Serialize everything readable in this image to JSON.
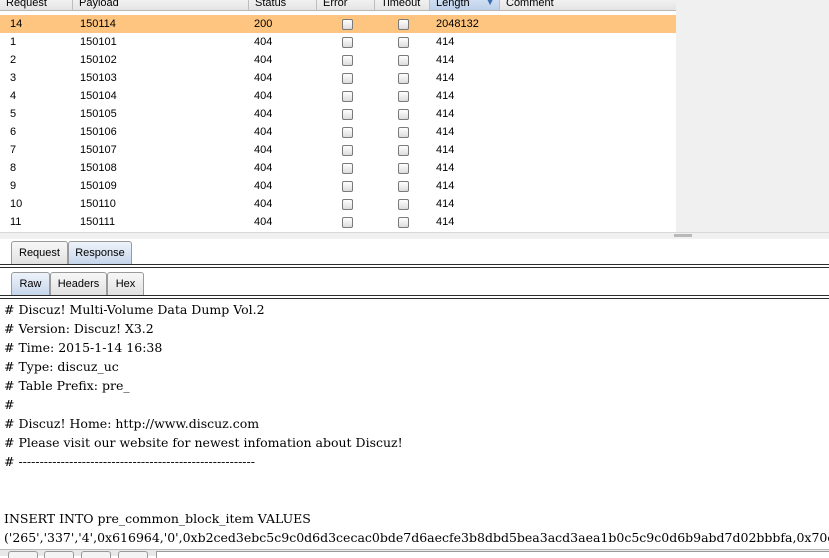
{
  "table": {
    "columns": [
      "Request",
      "Payload",
      "Status",
      "Error",
      "Timeout",
      "Length",
      "Comment"
    ],
    "sorted_column": "Length",
    "rows": [
      {
        "request": "14",
        "payload": "150114",
        "status": "200",
        "length": "2048132"
      },
      {
        "request": "1",
        "payload": "150101",
        "status": "404",
        "length": "414"
      },
      {
        "request": "2",
        "payload": "150102",
        "status": "404",
        "length": "414"
      },
      {
        "request": "3",
        "payload": "150103",
        "status": "404",
        "length": "414"
      },
      {
        "request": "4",
        "payload": "150104",
        "status": "404",
        "length": "414"
      },
      {
        "request": "5",
        "payload": "150105",
        "status": "404",
        "length": "414"
      },
      {
        "request": "6",
        "payload": "150106",
        "status": "404",
        "length": "414"
      },
      {
        "request": "7",
        "payload": "150107",
        "status": "404",
        "length": "414"
      },
      {
        "request": "8",
        "payload": "150108",
        "status": "404",
        "length": "414"
      },
      {
        "request": "9",
        "payload": "150109",
        "status": "404",
        "length": "414"
      },
      {
        "request": "10",
        "payload": "150110",
        "status": "404",
        "length": "414"
      },
      {
        "request": "11",
        "payload": "150111",
        "status": "404",
        "length": "414"
      }
    ]
  },
  "tabs": {
    "top": [
      "Request",
      "Response"
    ],
    "top_active": "Response",
    "view": [
      "Raw",
      "Headers",
      "Hex"
    ],
    "view_active": "Raw"
  },
  "editor": {
    "lines": [
      "# Discuz! Multi-Volume Data Dump Vol.2",
      "# Version: Discuz! X3.2",
      "# Time: 2015-1-14 16:38",
      "# Type: discuz_uc",
      "# Table Prefix: pre_",
      "#",
      "# Discuz! Home: http://www.discuz.com",
      "# Please visit our website for newest infomation about Discuz!",
      "# --------------------------------------------------------",
      "",
      "",
      "INSERT INTO pre_common_block_item VALUES",
      "('265','337','4',0x616964,'0',0xb2ced3ebc5c9c0d6d3cecac0bde7d6aecfe3b8dbd5bea3acd3aea1b0c5c9c0d6b9abd7d02bbbfa,0x70c"
    ]
  },
  "colors": {
    "selected_row": "#fdc57f",
    "tab_active": "#c6d6ec"
  }
}
